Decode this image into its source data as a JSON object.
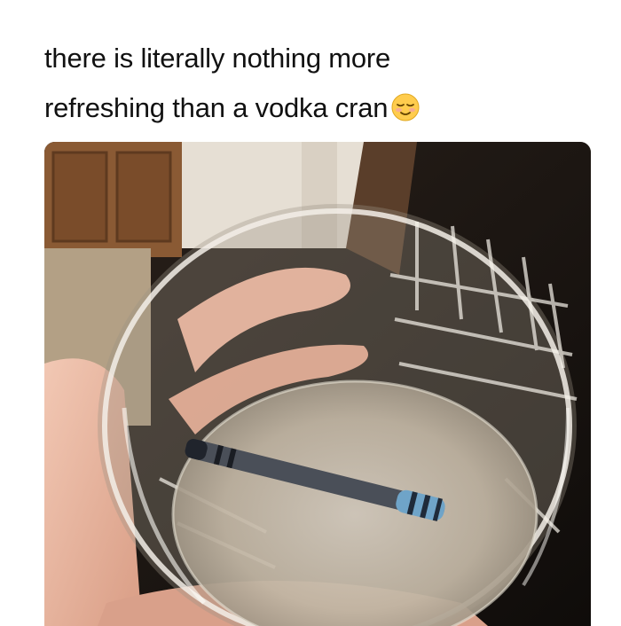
{
  "post": {
    "caption_line1": "there is literally nothing more",
    "caption_line2": "refreshing than a vodka cran",
    "emoji": "relieved-face"
  },
  "photo": {
    "subject": "glass of water with a crayon inside held in a hand",
    "colors": {
      "cabinet": "#8a5a34",
      "wall": "#e8e2d8",
      "floor": "#b9a58a",
      "dark_background": "#1a1512",
      "skin": "#e9b8a2",
      "water": "#cfc4b4",
      "crayon": "#3a3f4a"
    }
  }
}
